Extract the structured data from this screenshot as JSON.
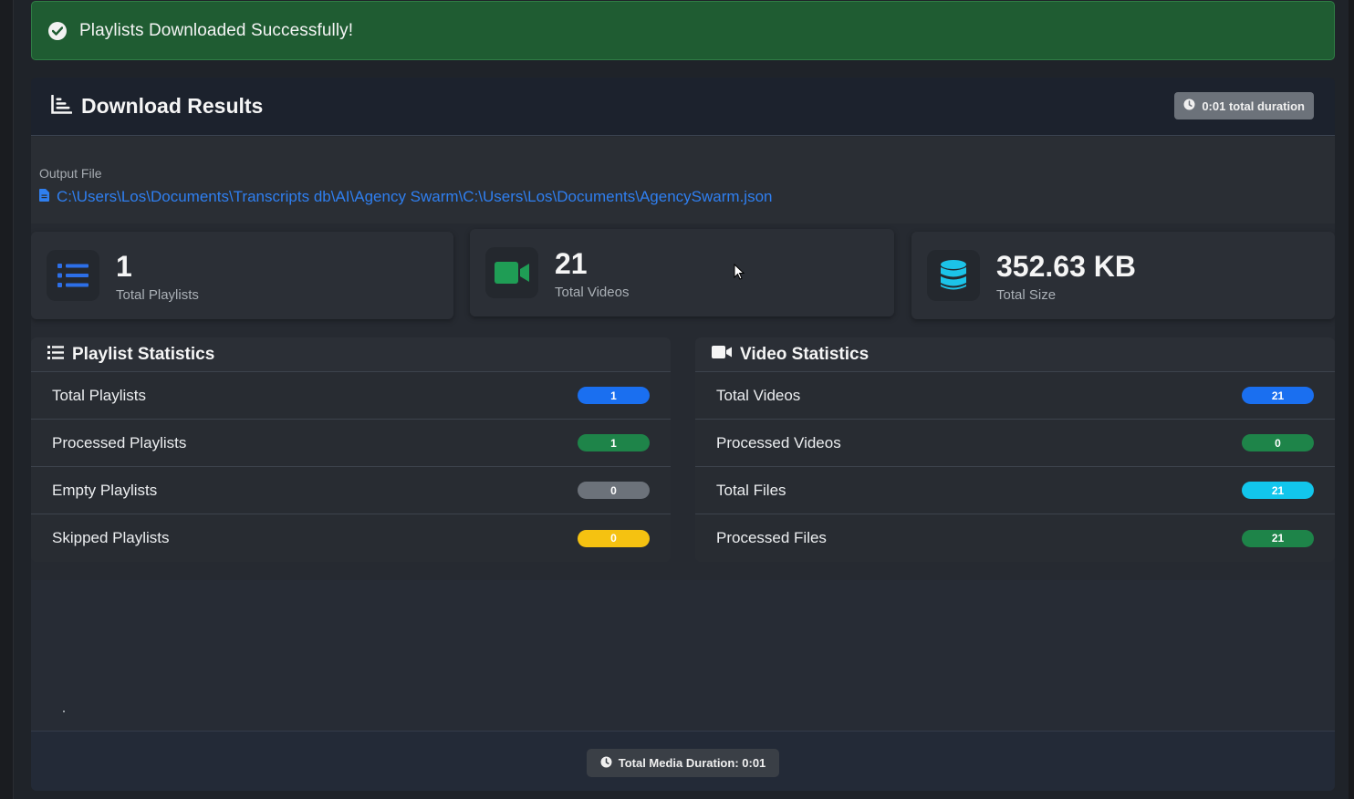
{
  "alert": {
    "message": "Playlists Downloaded Successfully!",
    "icon": "check-circle-icon"
  },
  "results": {
    "title": "Download Results",
    "duration_badge": "0:01 total duration",
    "output_label": "Output File",
    "output_path": "C:\\Users\\Los\\Documents\\Transcripts db\\AI\\Agency Swarm\\C:\\Users\\Los\\Documents\\AgencySwarm.json"
  },
  "stats": [
    {
      "value": "1",
      "label": "Total Playlists",
      "icon": "list-icon",
      "color": "#2d6fe8"
    },
    {
      "value": "21",
      "label": "Total Videos",
      "icon": "video-camera-icon",
      "color": "#1f9d55"
    },
    {
      "value": "352.63 KB",
      "label": "Total Size",
      "icon": "database-icon",
      "color": "#1cc3e8"
    }
  ],
  "playlist_stats": {
    "title": "Playlist Statistics",
    "rows": [
      {
        "label": "Total Playlists",
        "value": "1",
        "color": "#1a6ff0"
      },
      {
        "label": "Processed Playlists",
        "value": "1",
        "color": "#1e8449"
      },
      {
        "label": "Empty Playlists",
        "value": "0",
        "color": "#6c727a"
      },
      {
        "label": "Skipped Playlists",
        "value": "0",
        "color": "#f5c211"
      }
    ]
  },
  "video_stats": {
    "title": "Video Statistics",
    "rows": [
      {
        "label": "Total Videos",
        "value": "21",
        "color": "#1a6ff0"
      },
      {
        "label": "Processed Videos",
        "value": "0",
        "color": "#1e8449"
      },
      {
        "label": "Total Files",
        "value": "21",
        "color": "#12c6ec"
      },
      {
        "label": "Processed Files",
        "value": "21",
        "color": "#1e8449"
      }
    ]
  },
  "footer": {
    "total_media_duration": "Total Media Duration: 0:01"
  }
}
